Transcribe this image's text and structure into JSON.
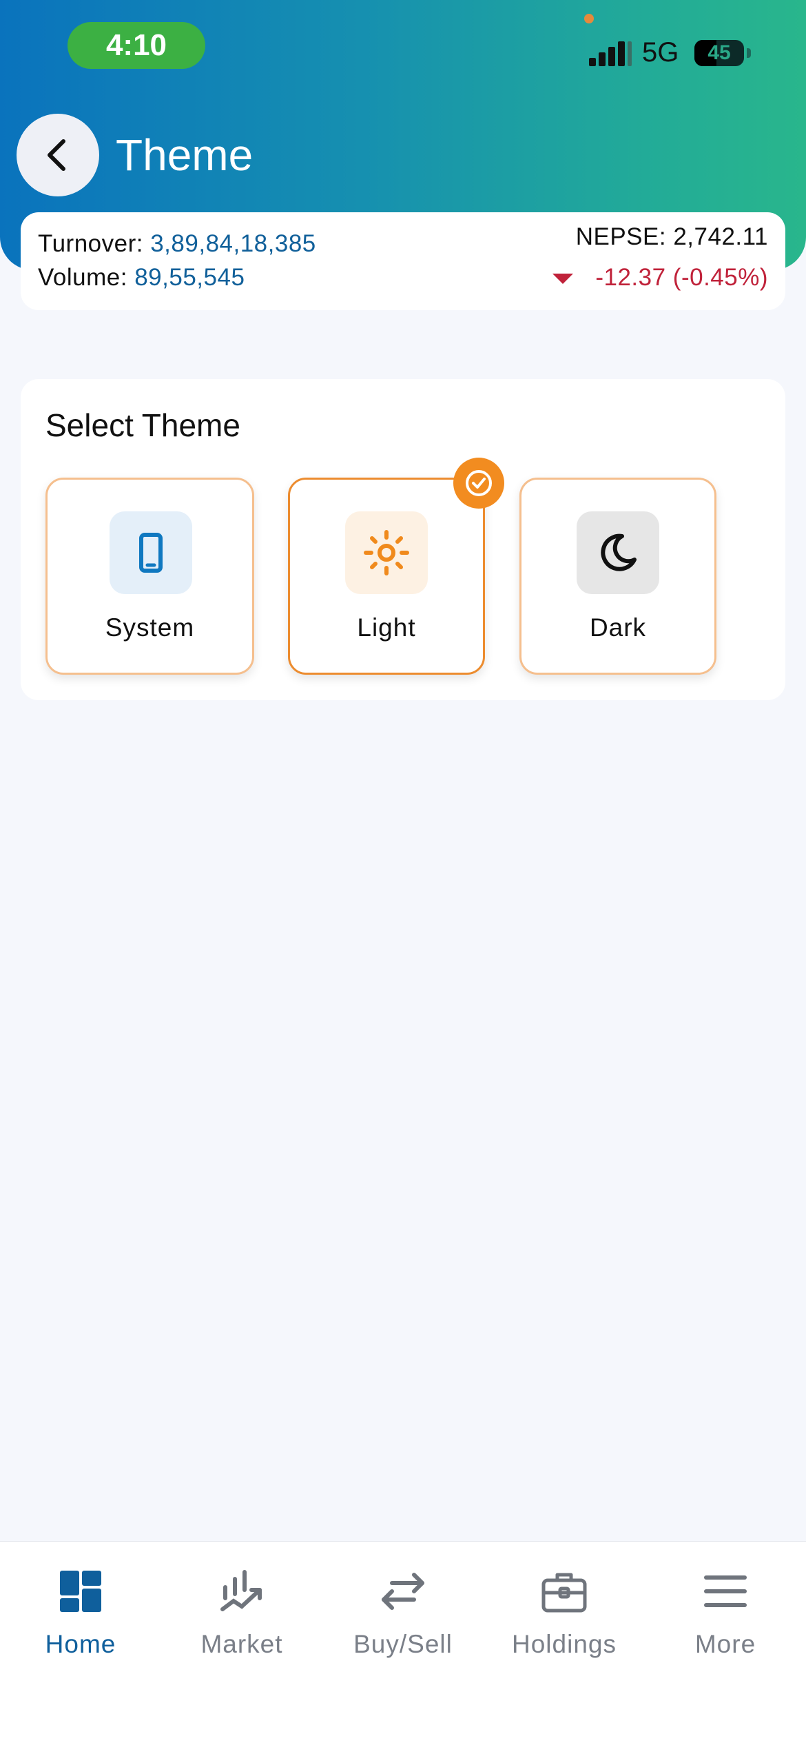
{
  "status_bar": {
    "time": "4:10",
    "network": "5G",
    "battery": "45",
    "battery_level": 0.45
  },
  "header": {
    "title": "Theme",
    "back_icon": "chevron-left-icon"
  },
  "market_summary": {
    "turnover_label": "Turnover:",
    "turnover_value": "3,89,84,18,385",
    "volume_label": "Volume:",
    "volume_value": "89,55,545",
    "index_label": "NEPSE:",
    "index_value": "2,742.11",
    "change_value": "-12.37 (-0.45%)",
    "change_direction": "down",
    "colors": {
      "value": "#11609a",
      "negative": "#c0223a"
    }
  },
  "theme_selector": {
    "title": "Select Theme",
    "selected": "Light",
    "options": [
      {
        "label": "System",
        "icon": "phone-icon",
        "icon_color": "#0f78c0",
        "icon_bg": "#e4eff9"
      },
      {
        "label": "Light",
        "icon": "sun-icon",
        "icon_color": "#f08a1c",
        "icon_bg": "#fdf1e3"
      },
      {
        "label": "Dark",
        "icon": "moon-icon",
        "icon_color": "#111111",
        "icon_bg": "#e6e6e6"
      }
    ],
    "accent_color": "#ec8c2f"
  },
  "bottom_nav": {
    "active": "Home",
    "items": [
      {
        "label": "Home",
        "icon": "home-grid-icon"
      },
      {
        "label": "Market",
        "icon": "market-chart-icon"
      },
      {
        "label": "Buy/Sell",
        "icon": "swap-arrows-icon"
      },
      {
        "label": "Holdings",
        "icon": "briefcase-icon"
      },
      {
        "label": "More",
        "icon": "menu-icon"
      }
    ],
    "active_color": "#0f5f9c",
    "inactive_color": "#7a7f88"
  }
}
